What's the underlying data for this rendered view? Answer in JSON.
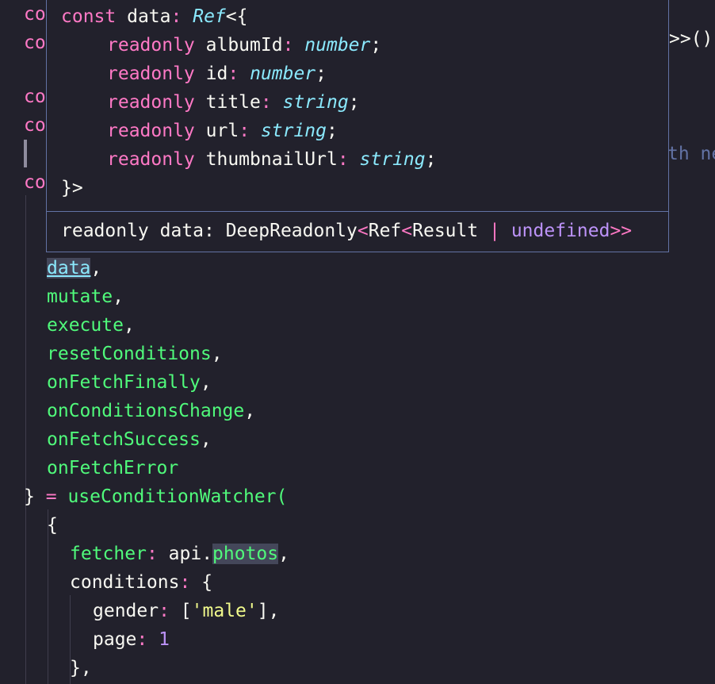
{
  "editor": {
    "partial_left": [
      "co",
      "co",
      "co",
      "co",
      "co"
    ],
    "partial_top_right": ">>()",
    "partial_ghost": "th ne",
    "destructure": [
      "data",
      "mutate",
      "execute",
      "resetConditions",
      "onFetchFinally",
      "onConditionsChange",
      "onFetchSuccess",
      "onFetchError"
    ],
    "close_brace": "}",
    "equals": "=",
    "call_fn": "useConditionWatcher(",
    "open_brace": "{",
    "fetcher_key": "fetcher",
    "fetcher_obj": "api.",
    "fetcher_prop": "photos",
    "conditions_key": "conditions",
    "gender_key": "gender",
    "gender_value": "'male'",
    "page_key": "page",
    "page_value": "1",
    "close_obj": "},"
  },
  "hover": {
    "line1_kw": "const",
    "line1_name": "data",
    "line1_type": "Ref",
    "line1_rest": "<{",
    "fields": [
      {
        "kw": "readonly",
        "name": "albumId",
        "type": "number"
      },
      {
        "kw": "readonly",
        "name": "id",
        "type": "number"
      },
      {
        "kw": "readonly",
        "name": "title",
        "type": "string"
      },
      {
        "kw": "readonly",
        "name": "url",
        "type": "string"
      },
      {
        "kw": "readonly",
        "name": "thumbnailUrl",
        "type": "string"
      }
    ],
    "close": "}>",
    "signature_prefix": "readonly data: DeepReadonly",
    "signature_ref": "Ref",
    "signature_result": "Result",
    "signature_pipe": "|",
    "signature_undefined": "undefined",
    "signature_close": ">>"
  },
  "colors": {
    "background": "#22212c",
    "keyword": "#ff79c6",
    "function": "#50fa7b",
    "type": "#8be9fd",
    "number": "#bd93f9",
    "string": "#f1fa8c"
  }
}
